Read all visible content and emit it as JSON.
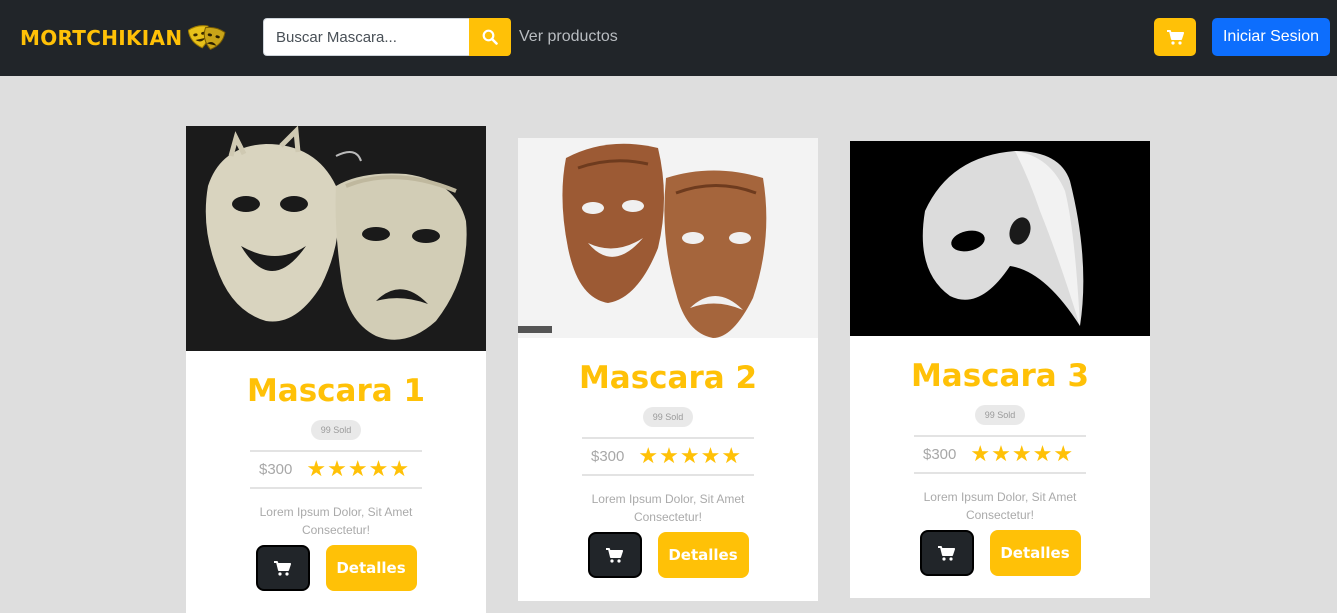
{
  "navbar": {
    "brand": "MORTCHIKIAN",
    "search_placeholder": "Buscar Mascara...",
    "products_link": "Ver productos",
    "login_label": "Iniciar Sesion"
  },
  "products": [
    {
      "title": "Mascara 1",
      "sold": "99 Sold",
      "price": "$300",
      "rating": 5,
      "description": "Lorem Ipsum Dolor, Sit Amet Consectetur!",
      "details_label": "Detalles"
    },
    {
      "title": "Mascara 2",
      "sold": "99 Sold",
      "price": "$300",
      "rating": 5,
      "description": "Lorem Ipsum Dolor, Sit Amet Consectetur!",
      "details_label": "Detalles"
    },
    {
      "title": "Mascara 3",
      "sold": "99 Sold",
      "price": "$300",
      "rating": 5,
      "description": "Lorem Ipsum Dolor, Sit Amet Consectetur!",
      "details_label": "Detalles"
    }
  ],
  "colors": {
    "accent": "#ffc107",
    "dark": "#212529",
    "primary": "#0d6efd",
    "background": "#dedede"
  }
}
